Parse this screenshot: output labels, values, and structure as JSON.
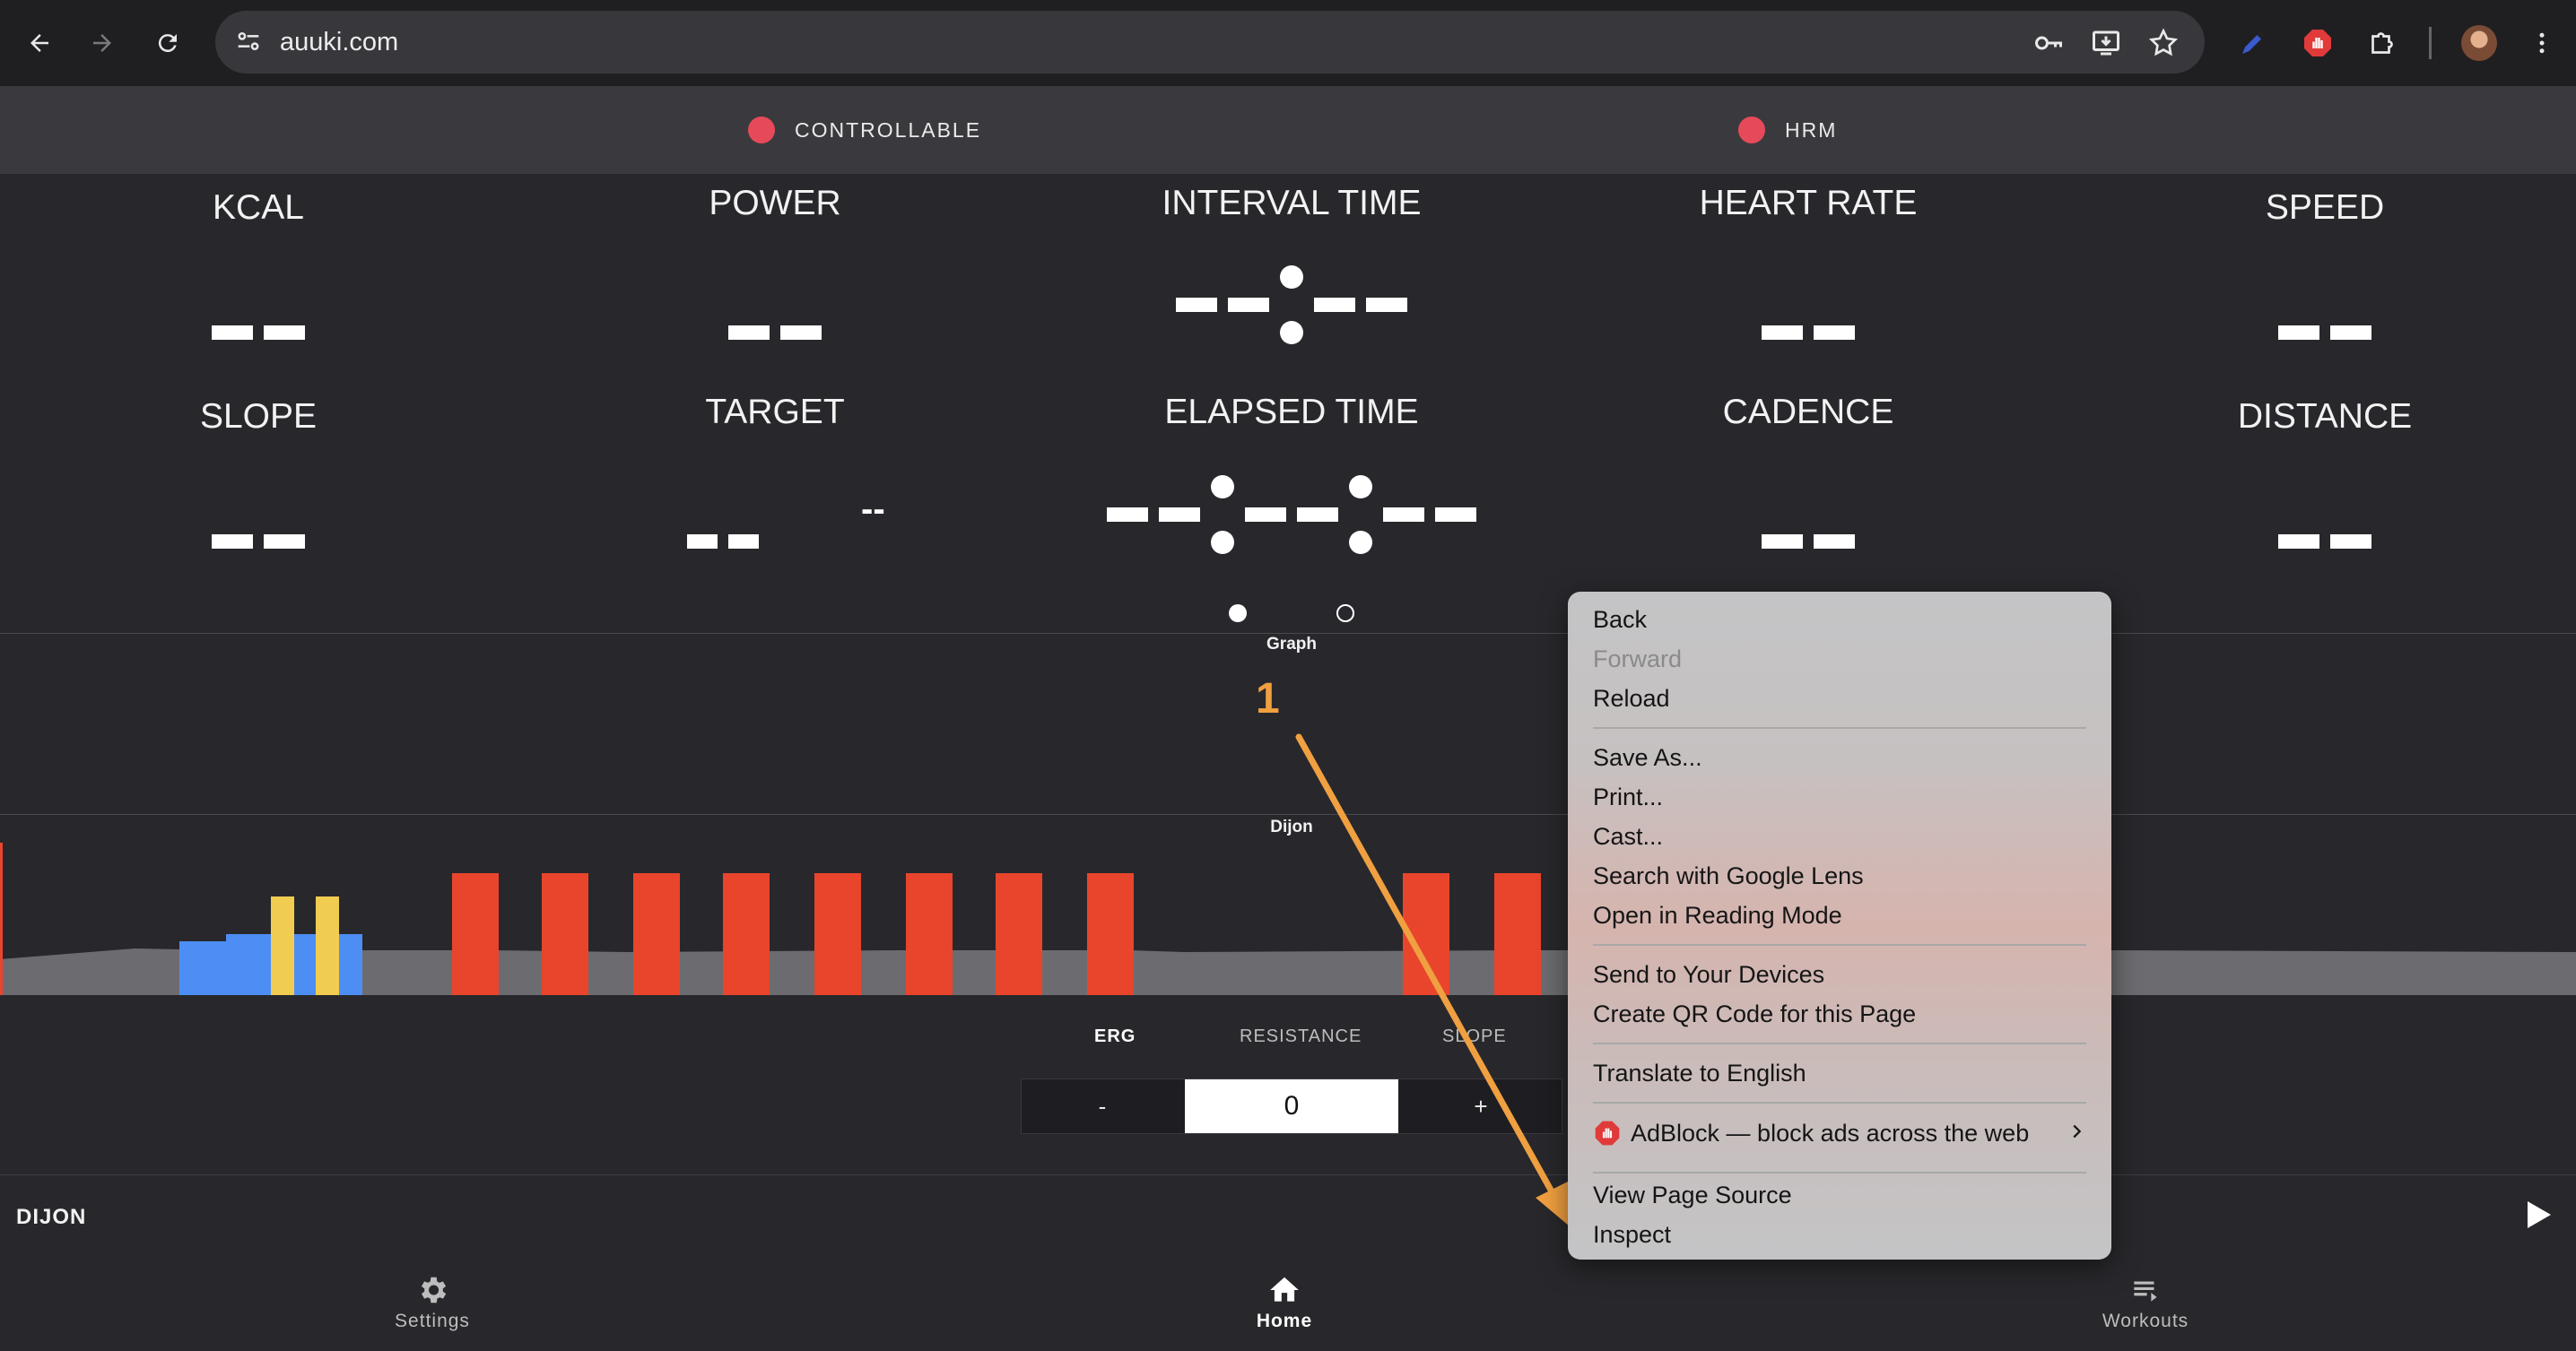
{
  "browser": {
    "url": "auuki.com"
  },
  "status": {
    "controllable": "CONTROLLABLE",
    "hrm": "HRM",
    "dot_color": "#e64a5a"
  },
  "metrics": {
    "kcal": {
      "label": "KCAL"
    },
    "power": {
      "label": "POWER"
    },
    "interval_time": {
      "label": "INTERVAL TIME"
    },
    "heart_rate": {
      "label": "HEART RATE"
    },
    "speed": {
      "label": "SPEED"
    },
    "slope": {
      "label": "SLOPE"
    },
    "target": {
      "label": "TARGET",
      "secondary": "--"
    },
    "elapsed_time": {
      "label": "ELAPSED TIME"
    },
    "cadence": {
      "label": "CADENCE"
    },
    "distance": {
      "label": "DISTANCE"
    }
  },
  "graph": {
    "label": "Graph",
    "workout_label": "Dijon",
    "annotation_number": "1"
  },
  "chart_data": {
    "type": "bar",
    "bars": [
      {
        "kind": "base",
        "color": "#6c6c70"
      },
      {
        "kind": "blue",
        "color": "#4d8ef5"
      },
      {
        "kind": "yellow",
        "color": "#f0cc50"
      },
      {
        "kind": "red",
        "color": "#e8452c"
      }
    ]
  },
  "modes": {
    "erg": "ERG",
    "resistance": "RESISTANCE",
    "slope": "SLOPE",
    "minus": "-",
    "value": "0",
    "plus": "+"
  },
  "footer": {
    "workout_name": "DIJON",
    "tabs": {
      "settings": "Settings",
      "home": "Home",
      "workouts": "Workouts"
    }
  },
  "context_menu": {
    "items": {
      "back": "Back",
      "forward": "Forward",
      "reload": "Reload",
      "save_as": "Save As...",
      "print": "Print...",
      "cast": "Cast...",
      "search_lens": "Search with Google Lens",
      "reading_mode": "Open in Reading Mode",
      "send_devices": "Send to Your Devices",
      "qr_code": "Create QR Code for this Page",
      "translate": "Translate to English",
      "adblock": "AdBlock — block ads across the web",
      "view_source": "View Page Source",
      "inspect": "Inspect"
    }
  }
}
